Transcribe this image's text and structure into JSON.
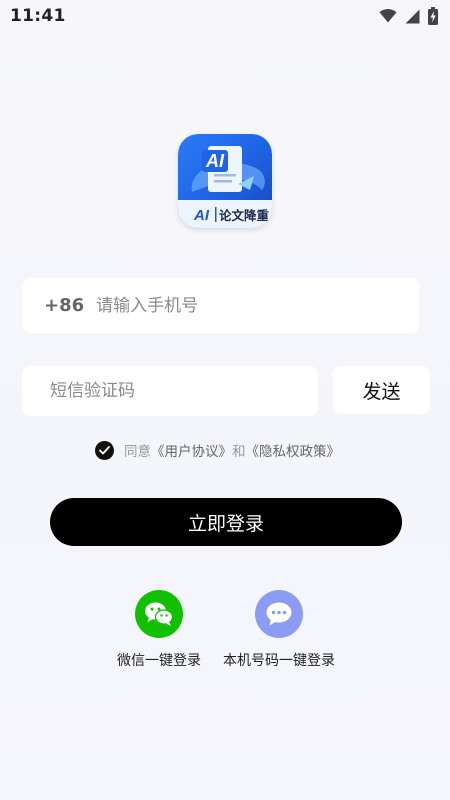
{
  "status_bar": {
    "time": "11:41"
  },
  "logo": {
    "badge_text": "AI",
    "app_name_ai": "AI",
    "app_name": "论文降重"
  },
  "phone": {
    "country_code": "+86",
    "placeholder": "请输入手机号",
    "value": ""
  },
  "code": {
    "placeholder": "短信验证码",
    "value": "",
    "send_label": "发送"
  },
  "agreement": {
    "prefix": "同意",
    "user_agreement": "《用户协议》",
    "connector": "和",
    "privacy_policy": "《隐私权政策》",
    "checked": true
  },
  "login_button": {
    "label": "立即登录"
  },
  "alt_logins": [
    {
      "label": "微信一键登录",
      "icon": "wechat-icon",
      "color": "#12c000"
    },
    {
      "label": "本机号码一键登录",
      "icon": "chat-bubble-icon",
      "color": "#8c9cf2"
    }
  ]
}
